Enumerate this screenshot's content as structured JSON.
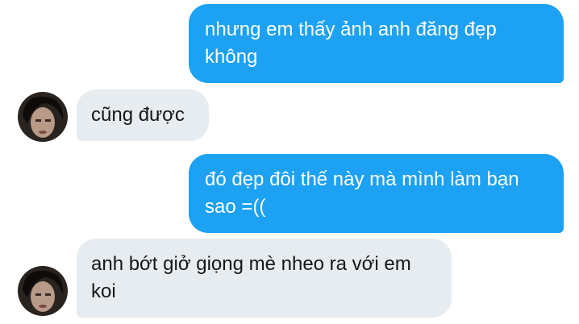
{
  "messages": [
    {
      "direction": "sent",
      "text": "nhưng em thấy ảnh anh đăng đẹp không"
    },
    {
      "direction": "received",
      "text": "cũng được",
      "avatar": "user-avatar"
    },
    {
      "direction": "sent",
      "text": "đó đẹp đôi thế này mà mình làm bạn sao =(("
    },
    {
      "direction": "received",
      "text": "anh bớt giở giọng mè nheo ra với em koi",
      "avatar": "user-avatar"
    }
  ],
  "colors": {
    "sent_bubble": "#1da1f2",
    "received_bubble": "#e6ecf0",
    "sent_text": "#ffffff",
    "received_text": "#14171a"
  }
}
